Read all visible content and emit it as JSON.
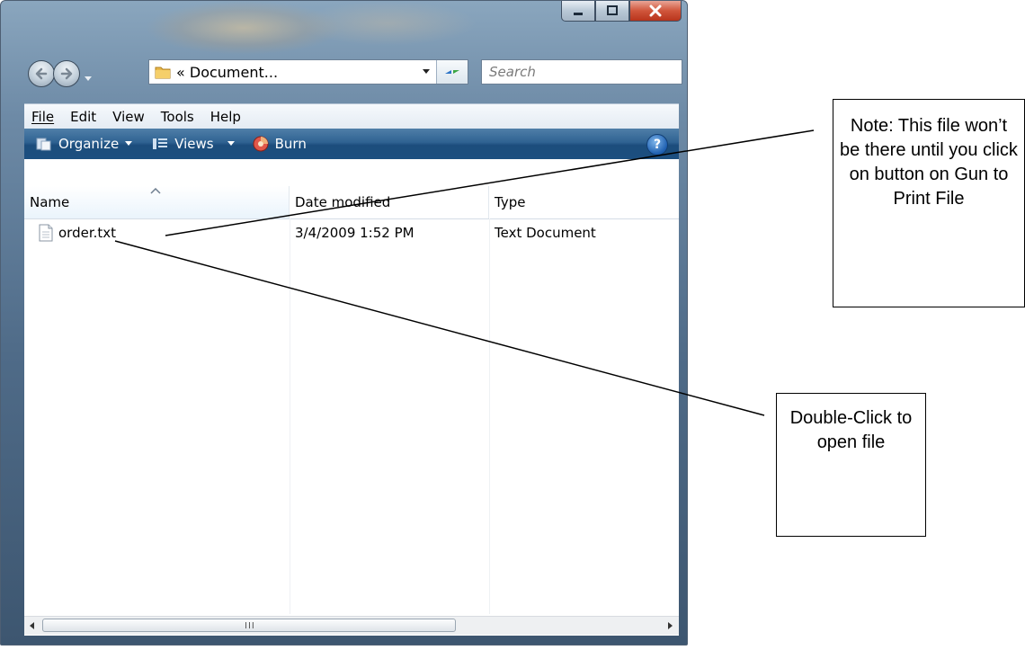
{
  "window": {
    "address": "« Document...",
    "search_placeholder": "Search"
  },
  "menu": {
    "file": "File",
    "edit": "Edit",
    "view": "View",
    "tools": "Tools",
    "help": "Help"
  },
  "toolbar": {
    "organize": "Organize",
    "views": "Views",
    "burn": "Burn"
  },
  "columns": {
    "name": "Name",
    "date": "Date modified",
    "type": "Type"
  },
  "files": [
    {
      "name": "order.txt",
      "date": "3/4/2009 1:52 PM",
      "type": "Text Document"
    }
  ],
  "scroll": {
    "grip": "III"
  },
  "callouts": {
    "note": "Note: This file won’t be there until you click on button on Gun to Print File",
    "double_click": "Double-Click to open file"
  },
  "colors": {
    "command_bar": "#2f6292",
    "close_button": "#d0553b"
  }
}
